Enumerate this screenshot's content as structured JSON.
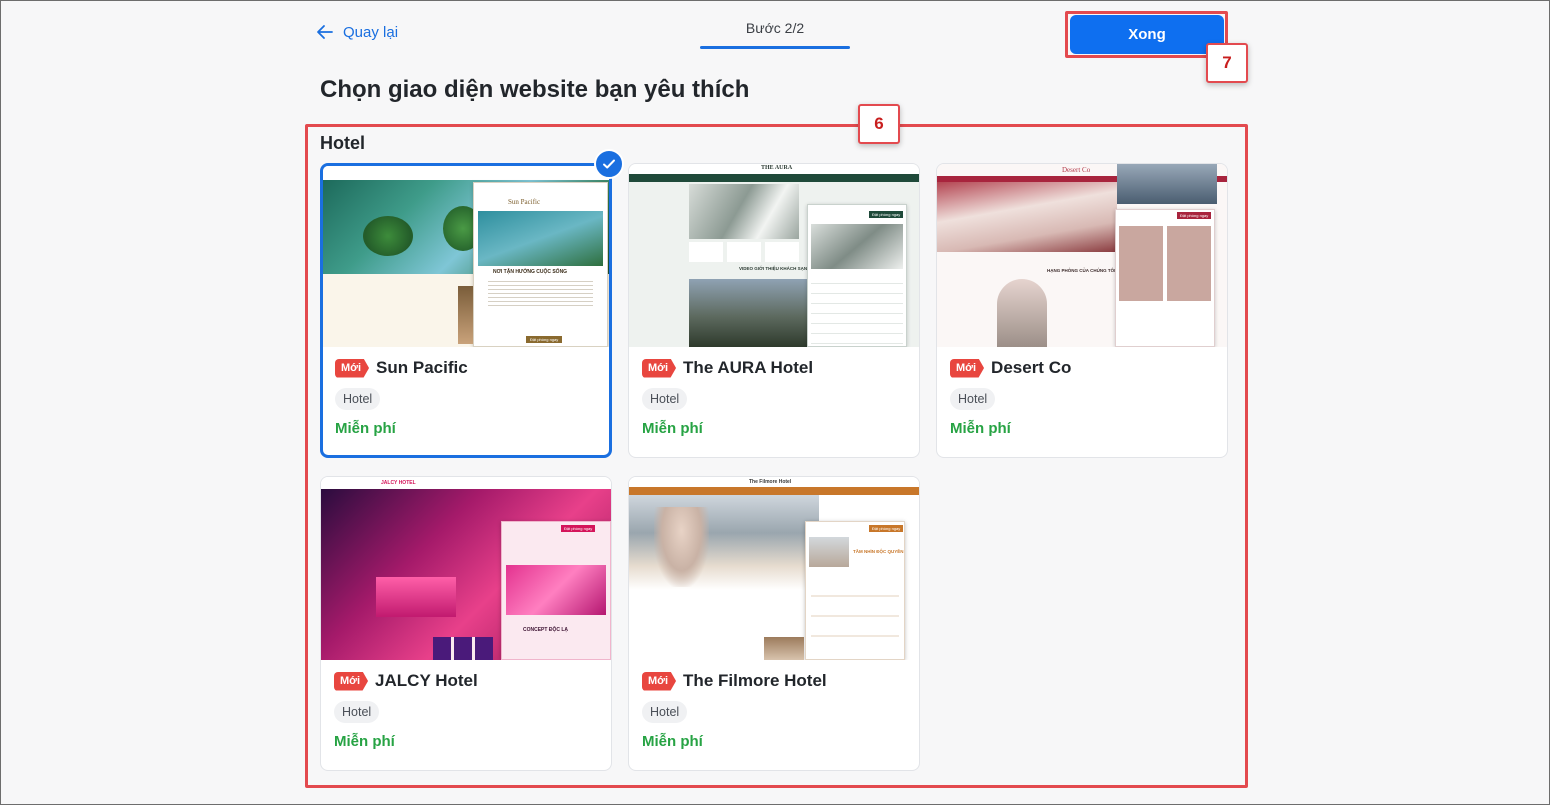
{
  "header": {
    "back_label": "Quay lại",
    "step_label": "Bước 2/2",
    "done_label": "Xong"
  },
  "page_title": "Chọn giao diện website bạn yêu thích",
  "section": {
    "title": "Hotel"
  },
  "callouts": [
    "6",
    "7"
  ],
  "colors": {
    "accent": "#1a6fe0",
    "highlight": "#e34a4f",
    "new_badge": "#e8463f",
    "price": "#27a344"
  },
  "cards": [
    {
      "badge": "Mới",
      "name": "Sun Pacific",
      "tag": "Hotel",
      "price": "Miễn phí",
      "selected": true,
      "thumb": {
        "title": "NƠI TẬN HƯỞNG CUỘC SỐNG",
        "brand": "Sun Pacific",
        "cta": "Đặt phòng ngay"
      }
    },
    {
      "badge": "Mới",
      "name": "The AURA Hotel",
      "tag": "Hotel",
      "price": "Miễn phí",
      "selected": false,
      "thumb": {
        "brand": "THE AURA",
        "title": "VIDEO GIỚI THIỆU KHÁCH SẠN",
        "cta": "Đặt phòng ngay"
      }
    },
    {
      "badge": "Mới",
      "name": "Desert Co",
      "tag": "Hotel",
      "price": "Miễn phí",
      "selected": false,
      "thumb": {
        "brand": "Desert Co",
        "title": "HẠNG PHÒNG CỦA CHÚNG TÔI",
        "cta": "Đặt phòng ngay"
      }
    },
    {
      "badge": "Mới",
      "name": "JALCY Hotel",
      "tag": "Hotel",
      "price": "Miễn phí",
      "selected": false,
      "thumb": {
        "brand": "JALCY HOTEL",
        "title": "CONCEPT ĐỘC LẠ",
        "cta": "Đặt phòng ngay"
      }
    },
    {
      "badge": "Mới",
      "name": "The Filmore Hotel",
      "tag": "Hotel",
      "price": "Miễn phí",
      "selected": false,
      "thumb": {
        "brand": "The Filmore Hotel",
        "title": "TẦM NHÌN ĐỘC QUYỀN",
        "cta": "Đặt phòng ngay"
      }
    }
  ]
}
